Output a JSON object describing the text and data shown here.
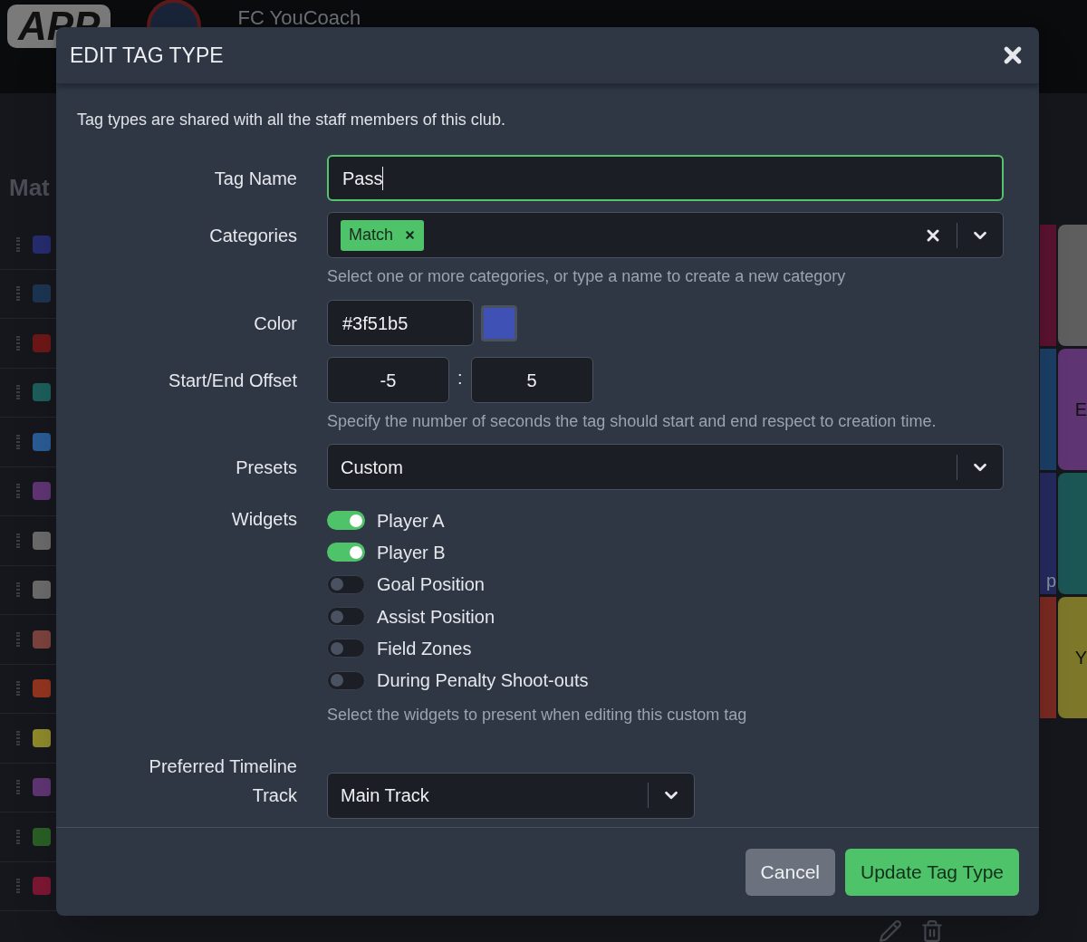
{
  "header": {
    "logo": "APP",
    "club": "FC YouCoach"
  },
  "background": {
    "heading": "Mat",
    "swatches": [
      {
        "color": "#262c6e"
      },
      {
        "color": "#1c3552"
      },
      {
        "color": "#6e1717"
      },
      {
        "color": "#1c5f5b"
      },
      {
        "color": "#2a5c96"
      },
      {
        "color": "#5f3573"
      },
      {
        "color": "#6b6b6b"
      },
      {
        "color": "#6b6b6b"
      },
      {
        "color": "#7c433d"
      },
      {
        "color": "#93351f"
      },
      {
        "color": "#8f8a2b"
      },
      {
        "color": "#5f3573"
      },
      {
        "color": "#2a5f26"
      },
      {
        "color": "#7c1734"
      }
    ],
    "strip": [
      {
        "color": "#5a1230"
      },
      {
        "color": "#1c3f66"
      },
      {
        "color": "#242a5e",
        "label": "p"
      },
      {
        "color": "#7a2a22"
      }
    ],
    "tiles": [
      {
        "color": "#5f5f5f"
      },
      {
        "color": "#5f3573",
        "label": "E"
      },
      {
        "color": "#1c5655"
      },
      {
        "color": "#7e782b",
        "label": "Y"
      }
    ]
  },
  "dialog": {
    "title": "EDIT TAG TYPE",
    "intro": "Tag types are shared with all the staff members of this club.",
    "tag_name": {
      "label": "Tag Name",
      "value": "Pass"
    },
    "categories": {
      "label": "Categories",
      "chips": [
        "Match"
      ],
      "help": "Select one or more categories, or type a name to create a new category"
    },
    "color": {
      "label": "Color",
      "value": "#3f51b5"
    },
    "offset": {
      "label": "Start/End Offset",
      "start": "-5",
      "separator": ":",
      "end": "5",
      "help": "Specify the number of seconds the tag should start and end respect to creation time."
    },
    "presets": {
      "label": "Presets",
      "value": "Custom"
    },
    "widgets": {
      "label": "Widgets",
      "items": [
        {
          "label": "Player A",
          "on": true
        },
        {
          "label": "Player B",
          "on": true
        },
        {
          "label": "Goal Position",
          "on": false
        },
        {
          "label": "Assist Position",
          "on": false
        },
        {
          "label": "Field Zones",
          "on": false
        },
        {
          "label": "During Penalty Shoot-outs",
          "on": false
        }
      ],
      "help": "Select the widgets to present when editing this custom tag"
    },
    "timeline": {
      "label": "Preferred Timeline Track",
      "value": "Main Track"
    },
    "buttons": {
      "cancel": "Cancel",
      "submit": "Update Tag Type"
    }
  }
}
